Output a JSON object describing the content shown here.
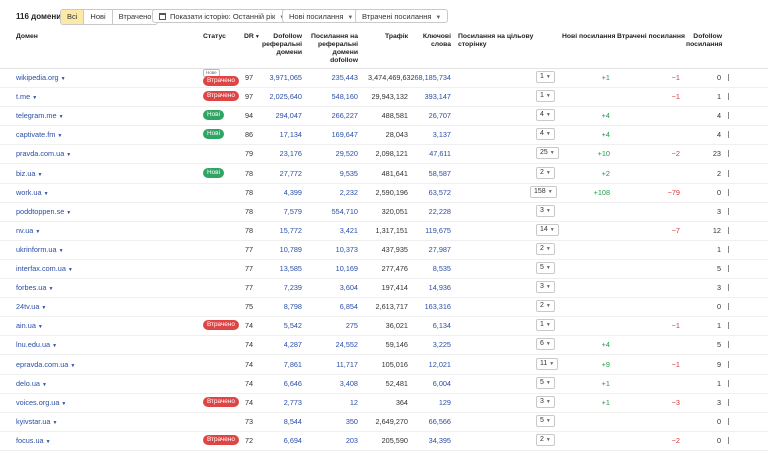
{
  "toolbar": {
    "count": "116 домени",
    "filters": [
      "Всі",
      "Нові",
      "Втрачено"
    ],
    "history_label": "Показати історію: Останній рік",
    "new_links_label": "Нові посилання",
    "lost_links_label": "Втрачені посилання"
  },
  "columns": {
    "domain": "Домен",
    "status": "Статус",
    "dr": "DR",
    "dofollow_ref": "Dofollow реферальні домени",
    "links_on_ref": "Посилання на реферальні домени dofollow",
    "traffic": "Трафік",
    "keywords": "Ключові слова",
    "links_to_target": "Посилання на цільову сторінку",
    "new_links": "Нові посилання",
    "lost_links": "Втрачені посилання",
    "dofollow_links": "Dofollow посилання"
  },
  "colors": {
    "lost": "#e04545",
    "new": "#2fa463",
    "link": "#2a4ea6",
    "active_filter": "#fde9a6"
  },
  "rows": [
    {
      "domain": "wikipedia.org",
      "status": "Втрачено",
      "status_type": "lost",
      "extra": "Нове",
      "dr": "97",
      "dref": "3,971,065",
      "lref": "235,443",
      "traffic": "3,474,469,632",
      "kw": "68,185,734",
      "target": "1",
      "new": "+1",
      "lost": "−1",
      "dof": "0"
    },
    {
      "domain": "t.me",
      "status": "Втрачено",
      "status_type": "lost",
      "extra": "",
      "dr": "97",
      "dref": "2,025,640",
      "lref": "548,160",
      "traffic": "29,943,132",
      "kw": "393,147",
      "target": "1",
      "new": "",
      "lost": "−1",
      "dof": "1"
    },
    {
      "domain": "telegram.me",
      "status": "Нові",
      "status_type": "new",
      "extra": "",
      "dr": "94",
      "dref": "294,047",
      "lref": "266,227",
      "traffic": "488,581",
      "kw": "26,707",
      "target": "4",
      "new": "+4",
      "lost": "",
      "dof": "4"
    },
    {
      "domain": "captivate.fm",
      "status": "Нові",
      "status_type": "new",
      "extra": "",
      "dr": "86",
      "dref": "17,134",
      "lref": "169,647",
      "traffic": "28,043",
      "kw": "3,137",
      "target": "4",
      "new": "+4",
      "lost": "",
      "dof": "4"
    },
    {
      "domain": "pravda.com.ua",
      "status": "",
      "status_type": "",
      "extra": "",
      "dr": "79",
      "dref": "23,176",
      "lref": "29,520",
      "traffic": "2,098,121",
      "kw": "47,611",
      "target": "25",
      "new": "+10",
      "lost": "−2",
      "dof": "23"
    },
    {
      "domain": "biz.ua",
      "status": "Нові",
      "status_type": "new",
      "extra": "",
      "dr": "78",
      "dref": "27,772",
      "lref": "9,535",
      "traffic": "481,641",
      "kw": "58,587",
      "target": "2",
      "new": "+2",
      "lost": "",
      "dof": "2"
    },
    {
      "domain": "work.ua",
      "status": "",
      "status_type": "",
      "extra": "",
      "dr": "78",
      "dref": "4,399",
      "lref": "2,232",
      "traffic": "2,590,196",
      "kw": "63,572",
      "target": "158",
      "new": "+108",
      "lost": "−79",
      "dof": "0"
    },
    {
      "domain": "poddtoppen.se",
      "status": "",
      "status_type": "",
      "extra": "",
      "dr": "78",
      "dref": "7,579",
      "lref": "554,710",
      "traffic": "320,051",
      "kw": "22,228",
      "target": "3",
      "new": "",
      "lost": "",
      "dof": "3"
    },
    {
      "domain": "nv.ua",
      "status": "",
      "status_type": "",
      "extra": "",
      "dr": "78",
      "dref": "15,772",
      "lref": "3,421",
      "traffic": "1,317,151",
      "kw": "119,675",
      "target": "14",
      "new": "",
      "lost": "−7",
      "dof": "12"
    },
    {
      "domain": "ukrinform.ua",
      "status": "",
      "status_type": "",
      "extra": "",
      "dr": "77",
      "dref": "10,789",
      "lref": "10,373",
      "traffic": "437,935",
      "kw": "27,987",
      "target": "2",
      "new": "",
      "lost": "",
      "dof": "1"
    },
    {
      "domain": "interfax.com.ua",
      "status": "",
      "status_type": "",
      "extra": "",
      "dr": "77",
      "dref": "13,585",
      "lref": "10,169",
      "traffic": "277,476",
      "kw": "8,535",
      "target": "5",
      "new": "",
      "lost": "",
      "dof": "5"
    },
    {
      "domain": "forbes.ua",
      "status": "",
      "status_type": "",
      "extra": "",
      "dr": "77",
      "dref": "7,239",
      "lref": "3,604",
      "traffic": "197,414",
      "kw": "14,936",
      "target": "3",
      "new": "",
      "lost": "",
      "dof": "3"
    },
    {
      "domain": "24tv.ua",
      "status": "",
      "status_type": "",
      "extra": "",
      "dr": "75",
      "dref": "8,798",
      "lref": "6,854",
      "traffic": "2,613,717",
      "kw": "163,316",
      "target": "2",
      "new": "",
      "lost": "",
      "dof": "0"
    },
    {
      "domain": "ain.ua",
      "status": "Втрачено",
      "status_type": "lost",
      "extra": "",
      "dr": "74",
      "dref": "5,542",
      "lref": "275",
      "traffic": "36,021",
      "kw": "6,134",
      "target": "1",
      "new": "",
      "lost": "−1",
      "dof": "1"
    },
    {
      "domain": "lnu.edu.ua",
      "status": "",
      "status_type": "",
      "extra": "",
      "dr": "74",
      "dref": "4,287",
      "lref": "24,552",
      "traffic": "59,146",
      "kw": "3,225",
      "target": "6",
      "new": "+4",
      "lost": "",
      "dof": "5"
    },
    {
      "domain": "epravda.com.ua",
      "status": "",
      "status_type": "",
      "extra": "",
      "dr": "74",
      "dref": "7,861",
      "lref": "11,717",
      "traffic": "105,016",
      "kw": "12,021",
      "target": "11",
      "new": "+9",
      "lost": "−1",
      "dof": "9"
    },
    {
      "domain": "delo.ua",
      "status": "",
      "status_type": "",
      "extra": "",
      "dr": "74",
      "dref": "6,646",
      "lref": "3,408",
      "traffic": "52,481",
      "kw": "6,004",
      "target": "5",
      "new": "+1",
      "lost": "",
      "dof": "1"
    },
    {
      "domain": "voices.org.ua",
      "status": "Втрачено",
      "status_type": "lost",
      "extra": "",
      "dr": "74",
      "dref": "2,773",
      "lref": "12",
      "traffic": "364",
      "kw": "129",
      "target": "3",
      "new": "+1",
      "lost": "−3",
      "dof": "3"
    },
    {
      "domain": "kyivstar.ua",
      "status": "",
      "status_type": "",
      "extra": "",
      "dr": "73",
      "dref": "8,544",
      "lref": "350",
      "traffic": "2,649,270",
      "kw": "66,566",
      "target": "5",
      "new": "",
      "lost": "",
      "dof": "0"
    },
    {
      "domain": "focus.ua",
      "status": "Втрачено",
      "status_type": "lost",
      "extra": "",
      "dr": "72",
      "dref": "6,694",
      "lref": "203",
      "traffic": "205,590",
      "kw": "34,395",
      "target": "2",
      "new": "",
      "lost": "−2",
      "dof": "0"
    }
  ]
}
